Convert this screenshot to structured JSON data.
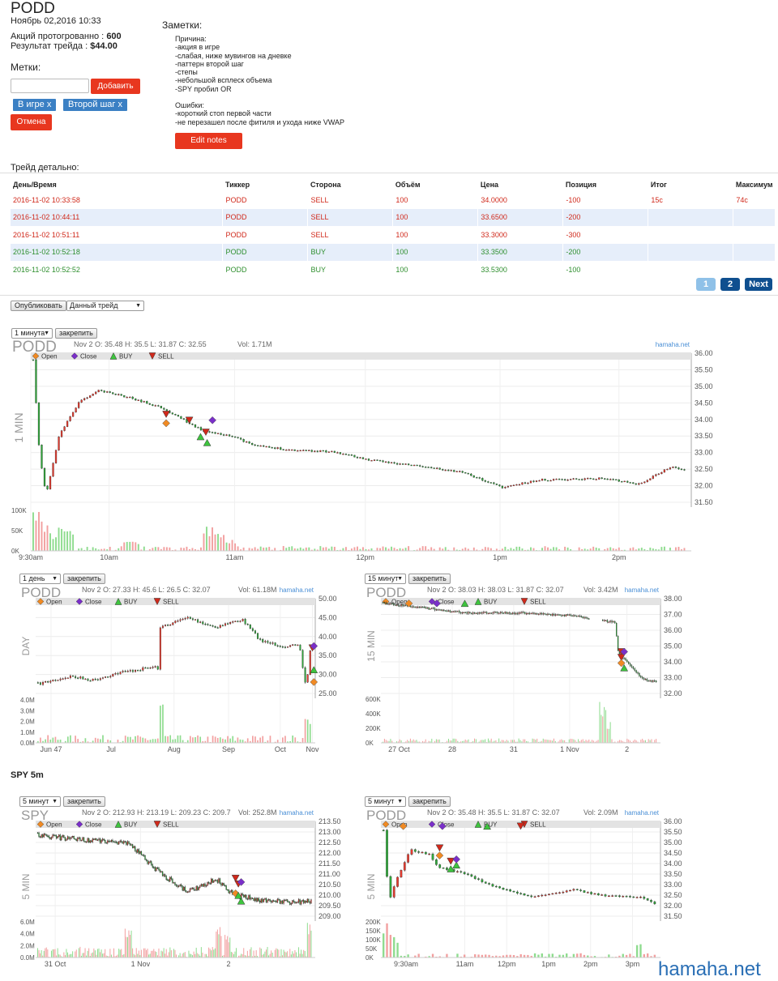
{
  "header": {
    "ticker": "PODD",
    "datetime": "Ноябрь 02,2016 10:33",
    "shares_label": "Акций протогрованно :",
    "shares_value": "600",
    "result_label": "Результат трейда :",
    "result_value": "$44.00"
  },
  "tags": {
    "label": "Метки:",
    "input_value": "",
    "add_button": "Добавить",
    "items": [
      "В игре x",
      "Второй шаг x"
    ],
    "cancel_button": "Отмена"
  },
  "notes": {
    "label": "Заметки:",
    "reason_title": "Причина:",
    "reasons": [
      "-акция в игре",
      "-слабая, ниже мувингов на дневке",
      "-паттерн второй шаг",
      "-степы",
      "-небольшой всплеск объема",
      "-SPY пробил OR"
    ],
    "errors_title": "Ошибки:",
    "errors": [
      "-короткий стоп первой части",
      "-не перезашел после фитиля и ухода ниже VWAP"
    ],
    "edit_button": "Edit notes"
  },
  "trades": {
    "title": "Трейд детально:",
    "columns": [
      "День/Время",
      "Тиккер",
      "Сторона",
      "Объём",
      "Цена",
      "Позиция",
      "Итог",
      "Максимум"
    ],
    "rows": [
      [
        "2016-11-02 10:33:58",
        "PODD",
        "SELL",
        "100",
        "34.0000",
        "-100",
        "15c",
        "74c"
      ],
      [
        "2016-11-02 10:44:11",
        "PODD",
        "SELL",
        "100",
        "33.6500",
        "-200",
        "",
        ""
      ],
      [
        "2016-11-02 10:51:11",
        "PODD",
        "SELL",
        "100",
        "33.3000",
        "-300",
        "",
        ""
      ],
      [
        "2016-11-02 10:52:18",
        "PODD",
        "BUY",
        "100",
        "33.3500",
        "-200",
        "",
        ""
      ],
      [
        "2016-11-02 10:52:52",
        "PODD",
        "BUY",
        "100",
        "33.5300",
        "-100",
        "",
        ""
      ]
    ],
    "pagination": [
      "1",
      "2",
      "Next"
    ]
  },
  "publish": {
    "button": "Опубликовать",
    "select": "Данный трейд"
  },
  "charts": [
    {
      "key": "c1",
      "interval": "1 минута",
      "pin": "закрепить",
      "symbol": "PODD",
      "period_label": "1 MIN",
      "ohlc": "Nov 2 O: 35.48 H: 35.5 L: 31.87 C: 32.55",
      "vol": "Vol: 1.71M",
      "y_ticks": [
        "36.00",
        "35.50",
        "35.00",
        "34.50",
        "34.00",
        "33.50",
        "33.00",
        "32.50",
        "32.00",
        "31.50"
      ],
      "vol_ticks": [
        "100K",
        "50K",
        "0K"
      ],
      "x_ticks": [
        "9:30am",
        "10am",
        "11am",
        "12pm",
        "1pm",
        "2pm"
      ]
    },
    {
      "key": "c2",
      "interval": "1 день",
      "pin": "закрепить",
      "symbol": "PODD",
      "period_label": "DAY",
      "ohlc": "Nov 2 O: 27.33 H: 45.6 L: 26.5 C: 32.07",
      "vol": "Vol: 61.18M",
      "y_ticks": [
        "50.00",
        "45.00",
        "40.00",
        "35.00",
        "30.00",
        "25.00"
      ],
      "vol_ticks": [
        "4.0M",
        "3.0M",
        "2.0M",
        "1.0M",
        "0.0M"
      ],
      "x_ticks": [
        "Jun 47",
        "Jul",
        "Aug",
        "Sep",
        "Oct",
        "Nov"
      ]
    },
    {
      "key": "c3",
      "interval": "15 минут",
      "pin": "закрепить",
      "symbol": "PODD",
      "period_label": "15 MIN",
      "ohlc": "Nov 2 O: 38.03 H: 38.03 L: 31.87 C: 32.07",
      "vol": "Vol: 3.42M",
      "y_ticks": [
        "38.00",
        "37.00",
        "36.00",
        "35.00",
        "34.00",
        "33.00",
        "32.00"
      ],
      "vol_ticks": [
        "600K",
        "400K",
        "200K",
        "0K"
      ],
      "x_ticks": [
        "27 Oct",
        "28",
        "31",
        "1 Nov",
        "2"
      ]
    },
    {
      "key": "c4",
      "interval": "5 минут",
      "pin": "закрепить",
      "symbol": "SPY",
      "period_label": "5 MIN",
      "ohlc": "Nov 2 O: 212.93 H: 213.19 L: 209.23 C: 209.7",
      "vol": "Vol: 252.8M",
      "y_ticks": [
        "213.50",
        "213.00",
        "212.50",
        "212.00",
        "211.50",
        "211.00",
        "210.50",
        "210.00",
        "209.50",
        "209.00"
      ],
      "vol_ticks": [
        "6.0M",
        "4.0M",
        "2.0M",
        "0.0M"
      ],
      "x_ticks": [
        "31 Oct",
        "1 Nov",
        "2"
      ]
    },
    {
      "key": "c5",
      "interval": "5 минут",
      "pin": "закрепить",
      "symbol": "PODD",
      "period_label": "5 MIN",
      "ohlc": "Nov 2 O: 35.48 H: 35.5 L: 31.87 C: 32.07",
      "vol": "Vol: 2.09M",
      "y_ticks": [
        "36.00",
        "35.50",
        "35.00",
        "34.50",
        "34.00",
        "33.50",
        "33.00",
        "32.50",
        "32.00",
        "31.50"
      ],
      "vol_ticks": [
        "200K",
        "150K",
        "100K",
        "50K",
        "0K"
      ],
      "x_ticks": [
        "9:30am",
        "11am",
        "12pm",
        "1pm",
        "2pm",
        "3pm"
      ]
    }
  ],
  "legend": {
    "open": "Open",
    "close": "Close",
    "buy": "BUY",
    "sell": "SELL"
  },
  "brand": {
    "small": "hamaha.net",
    "watermark": "hamaha.net"
  },
  "spy_section": "SPY 5m",
  "colors": {
    "red_button": "#e8371f",
    "tag_blue": "#3b80c4",
    "up": "#2fa83a",
    "down": "#e63a2e",
    "link_blue": "#2a6fb5"
  }
}
